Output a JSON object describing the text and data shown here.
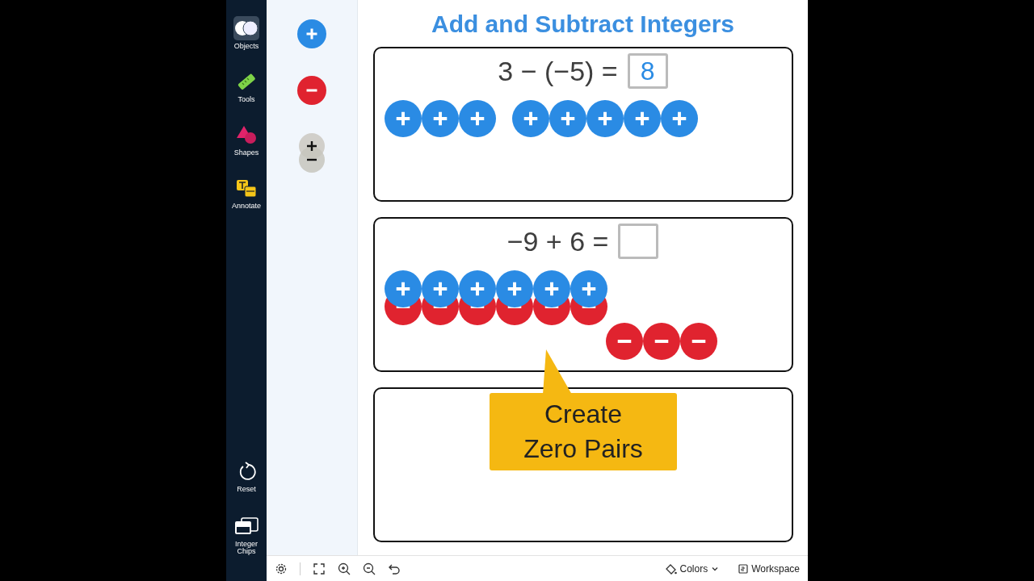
{
  "sidebar": {
    "items": [
      {
        "label": "Objects",
        "selected": true
      },
      {
        "label": "Tools",
        "selected": false
      },
      {
        "label": "Shapes",
        "selected": false
      },
      {
        "label": "Annotate",
        "selected": false
      }
    ],
    "bottom_items": [
      {
        "label": "Reset"
      },
      {
        "label": "Integer Chips"
      }
    ]
  },
  "palette": [
    {
      "kind": "positive"
    },
    {
      "kind": "negative"
    },
    {
      "kind": "zero_pair"
    }
  ],
  "title": "Add and Subtract Integers",
  "panels": [
    {
      "kind": "problem",
      "equation": "3 − (−5) =",
      "answer": "8",
      "chip_groups": [
        {
          "kind": "positive",
          "chips": [
            {
              "kind": "positive"
            },
            {
              "kind": "positive"
            },
            {
              "kind": "positive"
            }
          ]
        },
        {
          "kind": "positive",
          "chips": [
            {
              "kind": "positive"
            },
            {
              "kind": "positive"
            },
            {
              "kind": "positive"
            },
            {
              "kind": "positive"
            },
            {
              "kind": "positive"
            }
          ]
        }
      ]
    },
    {
      "kind": "problem",
      "equation": "−9 + 6 =",
      "chip_groups": [
        {
          "kind": "zero_pair",
          "chips": [
            {
              "kind": "zero_pair"
            },
            {
              "kind": "zero_pair"
            },
            {
              "kind": "zero_pair"
            },
            {
              "kind": "zero_pair"
            },
            {
              "kind": "zero_pair"
            },
            {
              "kind": "zero_pair"
            }
          ]
        },
        {
          "kind": "negative",
          "chips": [
            {
              "kind": "negative"
            },
            {
              "kind": "negative"
            },
            {
              "kind": "negative"
            }
          ]
        }
      ]
    },
    {
      "kind": "blank"
    }
  ],
  "callout": {
    "text": "Create\nZero Pairs"
  },
  "toolbar": {
    "colors_label": "Colors",
    "workspace_label": "Workspace"
  }
}
